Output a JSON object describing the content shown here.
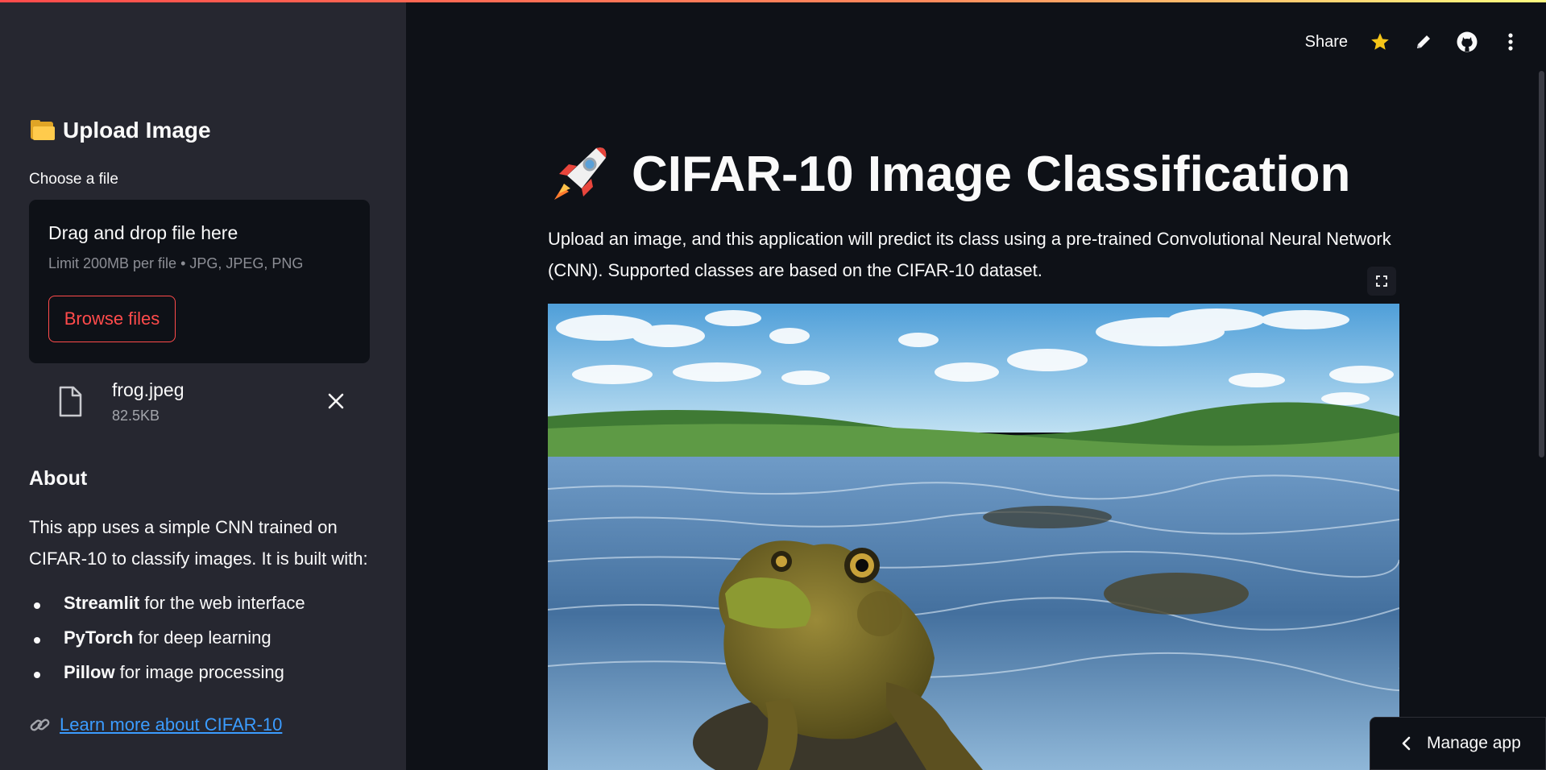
{
  "sidebar": {
    "title": "Upload Image",
    "title_icon": "folder-icon",
    "uploader": {
      "label": "Choose a file",
      "drop_text": "Drag and drop file here",
      "limit_text": "Limit 200MB per file • JPG, JPEG, PNG",
      "browse_label": "Browse files"
    },
    "file": {
      "name": "frog.jpeg",
      "size": "82.5KB"
    },
    "about": {
      "heading": "About",
      "text": "This app uses a simple CNN trained on CIFAR-10 to classify images. It is built with:",
      "items": [
        {
          "bold": "Streamlit",
          "rest": " for the web interface"
        },
        {
          "bold": "PyTorch",
          "rest": " for deep learning"
        },
        {
          "bold": "Pillow",
          "rest": " for image processing"
        }
      ],
      "link_text": "Learn more about CIFAR-10"
    }
  },
  "toolbar": {
    "share_label": "Share",
    "icons": [
      "star-icon",
      "pencil-icon",
      "github-icon",
      "more-vertical-icon"
    ]
  },
  "main": {
    "title": "CIFAR-10 Image Classification",
    "title_icon": "rocket-icon",
    "description": "Upload an image, and this application will predict its class using a pre-trained Convolutional Neural Network (CNN). Supported classes are based on the CIFAR-10 dataset.",
    "image_subject": "frog"
  },
  "manage_app": {
    "label": "Manage app"
  },
  "colors": {
    "background": "#0e1117",
    "sidebar": "#262730",
    "accent": "#ff4b4b",
    "link": "#3b9cff",
    "star": "#f5c518"
  }
}
